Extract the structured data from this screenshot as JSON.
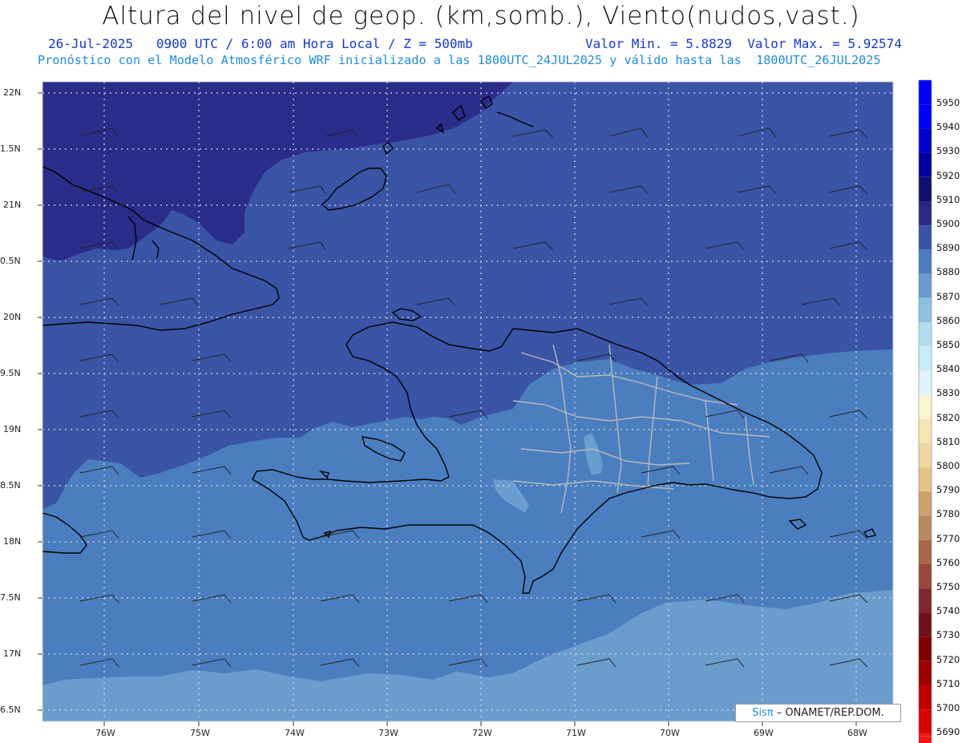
{
  "header": {
    "title": "Altura del nivel de geop. (km,somb.), Viento(nudos,vast.)",
    "subtitle_left": "26-Jul-2025   0900 UTC / 6:00 am Hora Local / Z = 500mb",
    "subtitle_right": "Valor Min. = 5.8829  Valor Max. = 5.92574",
    "subtitle2": "Pronóstico con el Modelo Atmosférico WRF inicializado a las 1800UTC_24JUL2025 y válido hasta las  1800UTC_26JUL2025"
  },
  "axes": {
    "lat_labels": [
      "22N",
      "1.5N",
      "21N",
      "0.5N",
      "20N",
      "9.5N",
      "19N",
      "8.5N",
      "18N",
      "7.5N",
      "17N",
      "6.5N"
    ],
    "lon_labels": [
      "76W",
      "75W",
      "74W",
      "73W",
      "72W",
      "71W",
      "70W",
      "69W",
      "68W"
    ]
  },
  "colorbar": {
    "labels": [
      "5950",
      "5940",
      "5930",
      "5920",
      "5910",
      "5900",
      "5890",
      "5880",
      "5870",
      "5860",
      "5850",
      "5840",
      "5830",
      "5820",
      "5810",
      "5800",
      "5790",
      "5780",
      "5770",
      "5760",
      "5750",
      "5740",
      "5730",
      "5720",
      "5710",
      "5700",
      "5690"
    ],
    "colors": [
      "#0000ff",
      "#0000d0",
      "#0000a0",
      "#101070",
      "#282888",
      "#3a54a6",
      "#4a7cbe",
      "#6a9cce",
      "#8ec0e0",
      "#b2def0",
      "#c8ecf6",
      "#ddf4fa",
      "#fbf6d0",
      "#f4e6b4",
      "#eed7a0",
      "#e4c28a",
      "#cea070",
      "#b88860",
      "#a86848",
      "#984838",
      "#802830",
      "#701018",
      "#800000",
      "#a00000",
      "#c00000",
      "#dd0000",
      "#ff1010"
    ],
    "tail_color": "#ff2020"
  },
  "colors": {
    "band_5920": "#2b2d8a",
    "band_5910": "#3a54a6",
    "band_5900": "#4b7ebf",
    "band_5890": "#6a9cce",
    "grid": "#d8d8d8",
    "coast": "#000000",
    "borders": "#b9b9b9"
  },
  "credit": {
    "sis": "Sisπ",
    "org": " – ONAMET/REP.DOM."
  }
}
